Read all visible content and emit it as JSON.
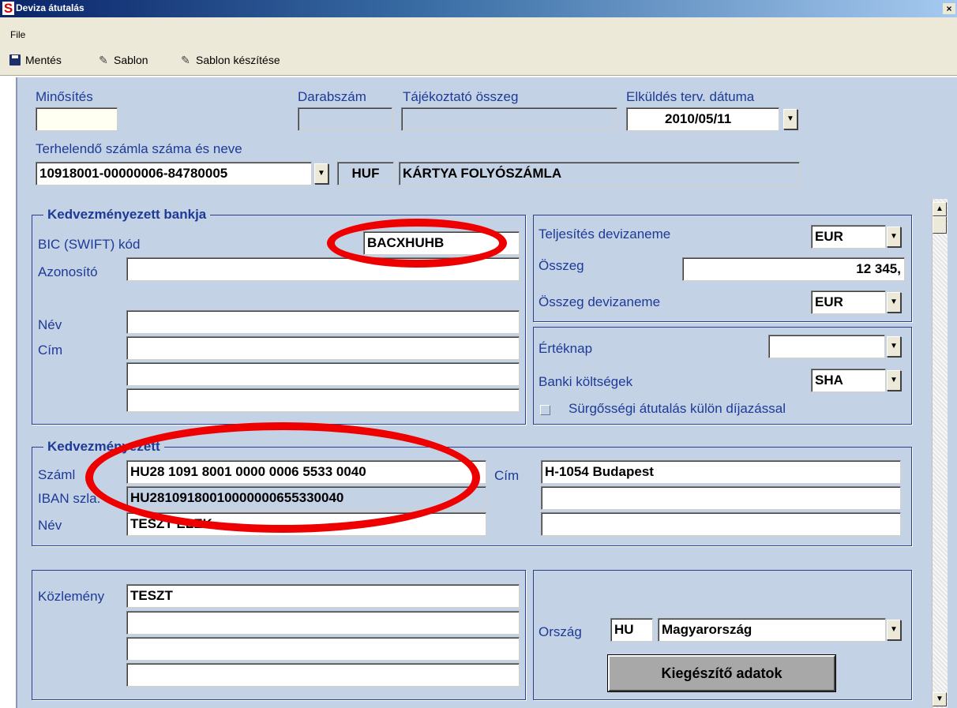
{
  "window": {
    "title": "Deviza átutalás",
    "close_glyph": "×",
    "app_icon": "S"
  },
  "menu": {
    "file": "File"
  },
  "toolbar": {
    "save": "Mentés",
    "template": "Sablon",
    "create_template": "Sablon készítése",
    "icons": {
      "save": "floppy-disk-icon",
      "template": "template-icon",
      "create_template": "template-icon"
    }
  },
  "header": {
    "minosites_label": "Minősítés",
    "minosites_value": "",
    "darabszam_label": "Darabszám",
    "darabszam_value": "",
    "tajekoztato_label": "Tájékoztató összeg",
    "tajekoztato_value": "",
    "elkuldes_label": "Elküldés terv. dátuma",
    "elkuldes_value": "2010/05/11",
    "terhelendo_label": "Terhelendő számla száma és neve",
    "terhelendo_account": "10918001-00000006-84780005",
    "terhelendo_currency": "HUF",
    "terhelendo_name": "KÁRTYA FOLYÓSZÁMLA"
  },
  "bank": {
    "title": "Kedvezményezett bankja",
    "bic_label": "BIC (SWIFT) kód",
    "bic_value": "BACXHUHB",
    "azonosito_label": "Azonosító",
    "azonosito_value": "",
    "nev_label": "Név",
    "nev_value": "",
    "cim_label": "Cím",
    "cim_lines": [
      "",
      "",
      ""
    ]
  },
  "amount": {
    "teljesites_label": "Teljesítés devizaneme",
    "teljesites_value": "EUR",
    "osszeg_label": "Összeg",
    "osszeg_value": "12 345,",
    "osszeg_deviza_label": "Összeg devizaneme",
    "osszeg_deviza_value": "EUR"
  },
  "options": {
    "erteknap_label": "Értéknap",
    "erteknap_value": "",
    "koltsegek_label": "Banki költségek",
    "koltsegek_value": "SHA",
    "surgos_label": "Sürgősségi átutalás külön díjazással"
  },
  "beneficiary": {
    "title": "Kedvezményezett",
    "szamla_label": "Száml",
    "szamla_value": "HU28 1091 8001 0000 0006 5533 0040",
    "iban_label": "IBAN szla.",
    "iban_value": "HU28109180010000000655330040",
    "nev_label": "Név",
    "nev_value": "TESZT ELEK",
    "cim_label": "Cím",
    "cim_lines": [
      "H-1054 Budapest",
      "",
      ""
    ]
  },
  "message": {
    "kozlemeny_label": "Közlemény",
    "lines": [
      "TESZT",
      "",
      "",
      ""
    ]
  },
  "country": {
    "orszag_label": "Ország",
    "code": "HU",
    "name": "Magyarország",
    "button": "Kiegészítő adatok"
  },
  "colors": {
    "annotation": "#ee0000",
    "panel": "#c4d2e5",
    "label": "#1e3a97"
  }
}
